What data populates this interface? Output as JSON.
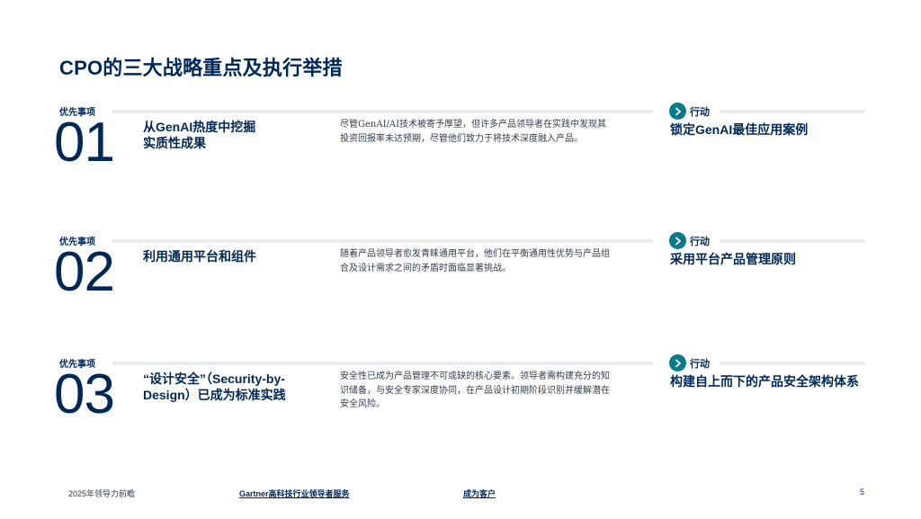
{
  "title": "CPO的三大战略重点及执行举措",
  "rows": [
    {
      "priority_label": "优先事项",
      "number": "01",
      "title": "从GenAI热度中挖掘\n实质性成果",
      "description": "尽管GenAI/AI技术被寄予厚望，但许多产品领导者在实践中发现其投资回报率未达预期，尽管他们致力于将技术深度融入产品。",
      "action_label": "行动",
      "action": "锁定GenAI最佳应用案例"
    },
    {
      "priority_label": "优先事项",
      "number": "02",
      "title": "利用通用平台和组件",
      "description": "随着产品领导者愈发青睐通用平台，他们在平衡通用性优势与产品组合及设计需求之间的矛盾时面临显著挑战。",
      "action_label": "行动",
      "action": "采用平台产品管理原则"
    },
    {
      "priority_label": "优先事项",
      "number": "03",
      "title": "“设计安全”（Security-by-Design）已成为标准实践",
      "description": "安全性已成为产品管理不可或缺的核心要素。领导者需构建充分的知识储备，与安全专家深度协同，在产品设计初期阶段识别并缓解潜在安全风险。",
      "action_label": "行动",
      "action": "构建自上而下的产品安全架构体系"
    }
  ],
  "footer": {
    "left": "2025年领导力前瞻",
    "link1": "Gartner高科技行业领导者服务",
    "link2": "成为客户",
    "page": "5"
  },
  "colors": {
    "navy": "#002856",
    "teal": "#0a7a8a",
    "divider": "#e9ebee"
  },
  "icons": {
    "action": "chevron-right-icon"
  }
}
